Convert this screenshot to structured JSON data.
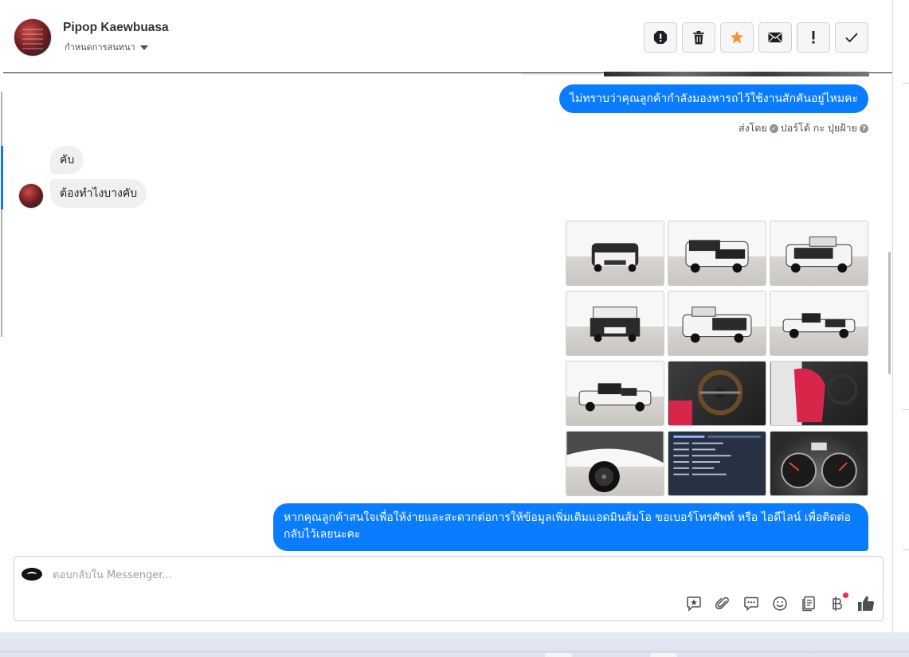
{
  "header": {
    "name": "Pipop Kaewbuasa",
    "assign_label": "กำหนดการสนทนา"
  },
  "header_actions": [
    {
      "id": "spam",
      "icon": "alert-octagon-icon"
    },
    {
      "id": "delete",
      "icon": "trash-icon"
    },
    {
      "id": "star",
      "icon": "star-icon",
      "color": "#f7923a"
    },
    {
      "id": "unread",
      "icon": "envelope-icon"
    },
    {
      "id": "follow-up",
      "icon": "exclamation-icon"
    },
    {
      "id": "done",
      "icon": "check-icon"
    }
  ],
  "messages": [
    {
      "from": "page",
      "text": "ไม่ทราบว่าคุณลูกค้ากำลังมองหารถไว้ใช้งานสักคันอยู่ไหมคะ"
    },
    {
      "from": "page_meta",
      "sent_by_prefix": "ส่งโดย",
      "sender": "ปอร์โต้ กะ ปุยฝ้าย"
    },
    {
      "from": "customer",
      "text": "คับ"
    },
    {
      "from": "customer",
      "text": "ต้องทำไงบางคับ"
    },
    {
      "from": "page",
      "type": "gallery",
      "count": 12
    },
    {
      "from": "page",
      "text": "หากคุณลูกค้าสนใจเพื่อให้ง่ายและสะดวกต่อการให้ข้อมูลเพิ่มเติมแอดมินส้มโอ ขอเบอร์โทรศัพท์ หรือ ไอดีไลน์ เพื่อติดต่อกลับไว้เลยนะคะ"
    }
  ],
  "composer": {
    "placeholder": "ตอบกลับใน Messenger...",
    "tools": [
      "sticker-icon",
      "paperclip-icon",
      "saved-reply-icon",
      "emoji-icon",
      "notes-icon",
      "baht-payment-icon",
      "like-icon"
    ]
  },
  "colors": {
    "accent": "#0a7cff",
    "incoming_bubble": "#f0f0f0",
    "star": "#f7923a",
    "badge": "#f02849"
  }
}
